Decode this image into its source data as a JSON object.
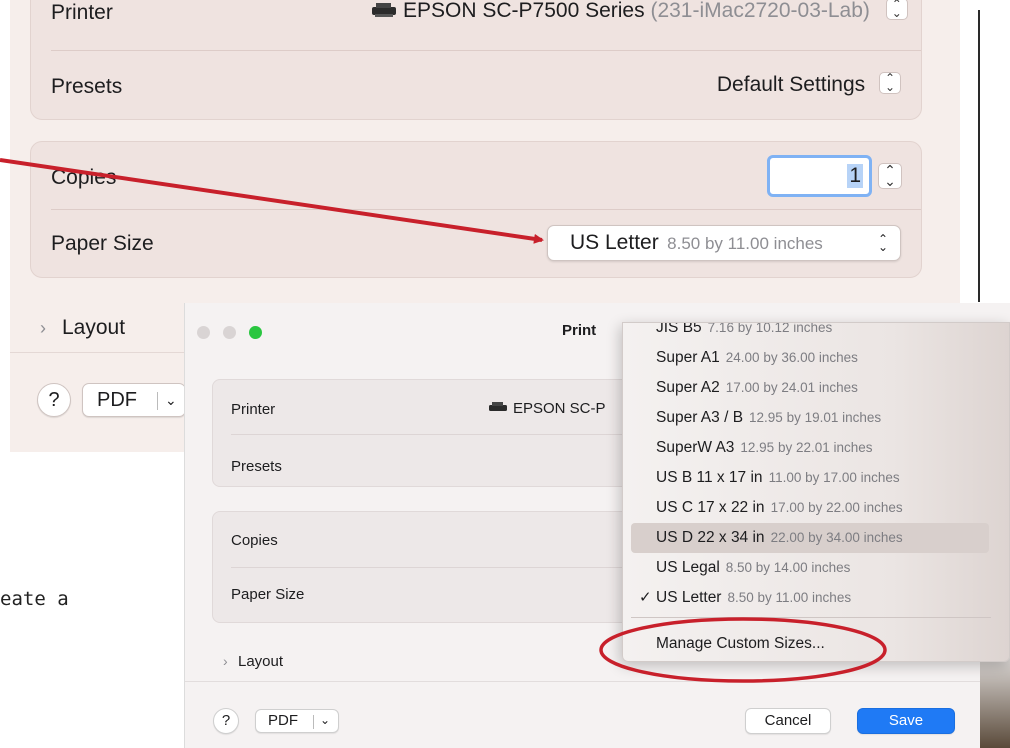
{
  "zoomed_dialog": {
    "printer_label": "Printer",
    "printer_value": "EPSON SC-P7500 Series",
    "printer_host": "(231-iMac2720-03-Lab)",
    "presets_label": "Presets",
    "presets_value": "Default Settings",
    "copies_label": "Copies",
    "copies_value": "1",
    "paper_size_label": "Paper Size",
    "paper_size_value": "US Letter",
    "paper_size_dims": "8.50 by 11.00 inches",
    "layout_label": "Layout",
    "help_label": "?",
    "pdf_label": "PDF"
  },
  "dialog": {
    "title": "Print",
    "printer_label": "Printer",
    "printer_value": "EPSON SC-P",
    "presets_label": "Presets",
    "copies_label": "Copies",
    "paper_size_label": "Paper Size",
    "layout_label": "Layout",
    "help_label": "?",
    "pdf_label": "PDF",
    "cancel_label": "Cancel",
    "save_label": "Save"
  },
  "paper_menu": {
    "items": [
      {
        "name": "JIS B5",
        "dims": "7.16 by 10.12 inches"
      },
      {
        "name": "Super A1",
        "dims": "24.00 by 36.00 inches"
      },
      {
        "name": "Super A2",
        "dims": "17.00 by 24.01 inches"
      },
      {
        "name": "Super A3 / B",
        "dims": "12.95 by 19.01 inches"
      },
      {
        "name": "SuperW A3",
        "dims": "12.95 by 22.01 inches"
      },
      {
        "name": "US B 11 x 17 in",
        "dims": "11.00 by 17.00 inches"
      },
      {
        "name": "US C 17 x 22 in",
        "dims": "17.00 by 22.00 inches"
      },
      {
        "name": "US D 22 x 34 in",
        "dims": "22.00 by 34.00 inches",
        "highlighted": true
      },
      {
        "name": "US Legal",
        "dims": "8.50 by 14.00 inches"
      },
      {
        "name": "US Letter",
        "dims": "8.50 by 11.00 inches",
        "checked": true
      }
    ],
    "manage_label": "Manage Custom Sizes..."
  },
  "caption": {
    "text": "eate a"
  },
  "colors": {
    "annotation_red": "#c8202b",
    "accent_blue": "#1f7af5",
    "traffic_green": "#2ac640",
    "focus_ring": "#7fb2f4"
  },
  "icons": [
    "printer-icon",
    "stepper-icon",
    "chevron-down-icon",
    "chevron-right-icon",
    "checkmark-icon"
  ]
}
